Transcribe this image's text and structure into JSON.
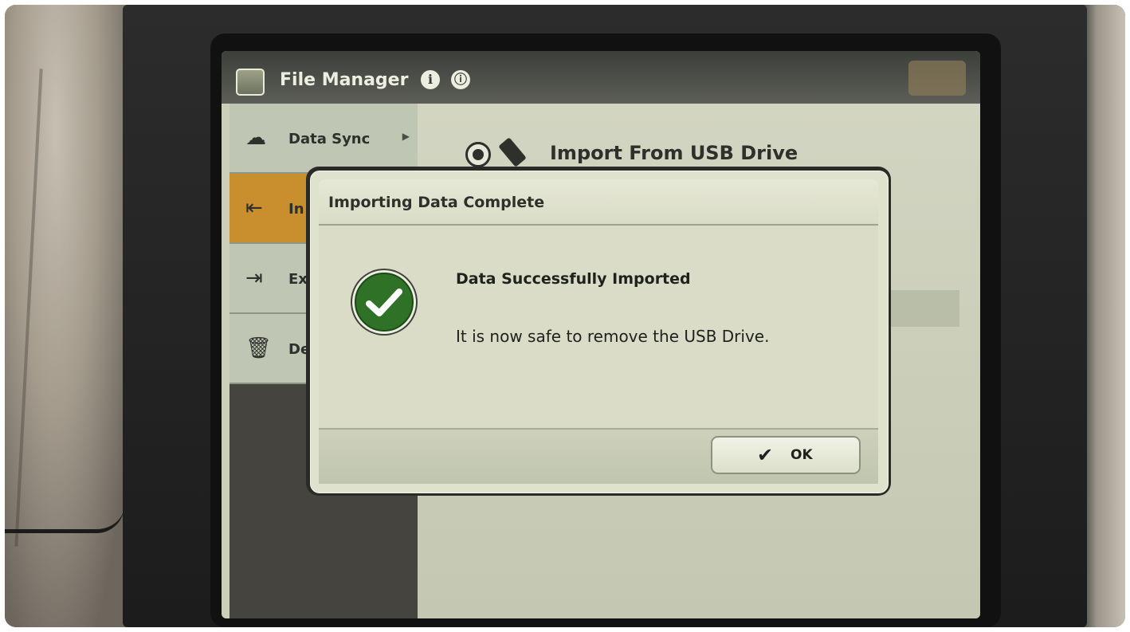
{
  "app": {
    "title": "File Manager"
  },
  "sidebar": {
    "items": [
      {
        "label": "Data Sync",
        "icon": "cloud-upload-icon",
        "has_submenu": true,
        "active": false
      },
      {
        "label": "In",
        "icon": "import-icon",
        "has_submenu": false,
        "active": true
      },
      {
        "label": "Ex",
        "icon": "export-icon",
        "has_submenu": false,
        "active": false
      },
      {
        "label": "De",
        "icon": "trash-icon",
        "has_submenu": false,
        "active": false
      }
    ]
  },
  "main": {
    "option_label": "Import From USB Drive",
    "option_selected": true
  },
  "dialog": {
    "title": "Importing Data Complete",
    "message_title": "Data Successfully Imported",
    "message_text": "It is now safe to remove the USB Drive.",
    "ok_label": "OK",
    "status_icon": "checkmark-circle-icon"
  },
  "colors": {
    "accent_active": "#c98f2e",
    "success_green": "#2f7127",
    "dialog_bg": "#dfe2cd"
  }
}
